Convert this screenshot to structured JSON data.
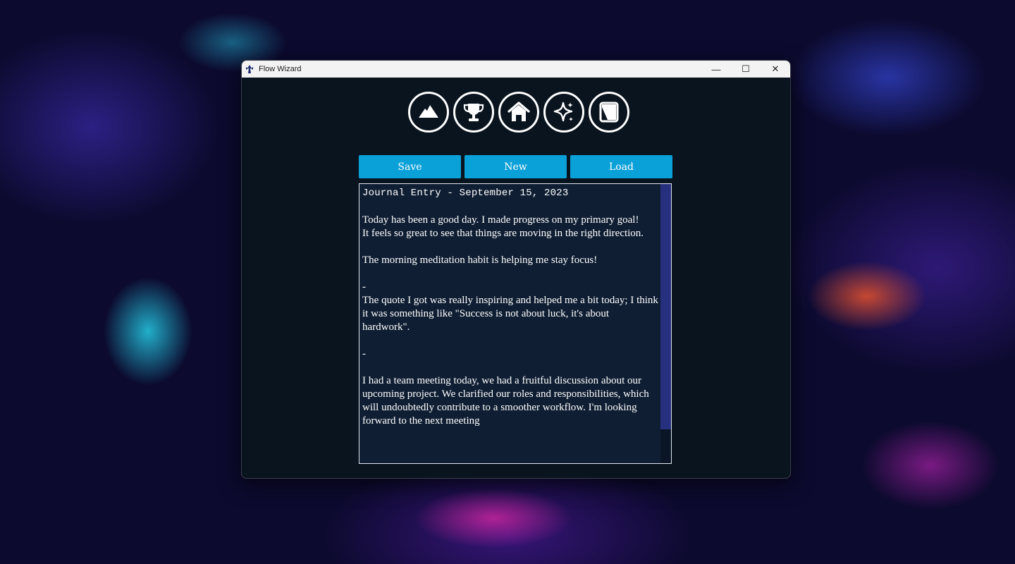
{
  "window": {
    "title": "Flow Wizard",
    "controls": {
      "minimize": "—",
      "maximize": "☐",
      "close": "✕"
    }
  },
  "nav": {
    "items": [
      {
        "icon": "mountain-icon"
      },
      {
        "icon": "trophy-icon"
      },
      {
        "icon": "home-icon"
      },
      {
        "icon": "sparkles-icon"
      },
      {
        "icon": "notebook-icon"
      }
    ]
  },
  "toolbar": {
    "save_label": "Save",
    "new_label": "New",
    "load_label": "Load"
  },
  "editor": {
    "lines": [
      "Journal Entry - September 15, 2023",
      "",
      "Today has been a good day. I made progress on my primary goal!",
      "It feels so great to see that things are moving in the right direction.",
      "",
      "The morning meditation habit is helping me stay focus!",
      "",
      "-",
      "The quote I got was really inspiring and helped me a bit today; I think it was something like \"Success is not about luck, it's about hardwork\".",
      "",
      "-",
      "",
      "I had a team meeting today, we had a fruitful discussion about our upcoming project. We clarified our roles and responsibilities, which will undoubtedly contribute to a smoother workflow. I'm looking forward to the next meeting"
    ]
  },
  "colors": {
    "accent": "#0aa0d8",
    "window_bg": "#09141f",
    "editor_bg": "#0f1e33",
    "scrollbar_thumb": "#26307e"
  }
}
